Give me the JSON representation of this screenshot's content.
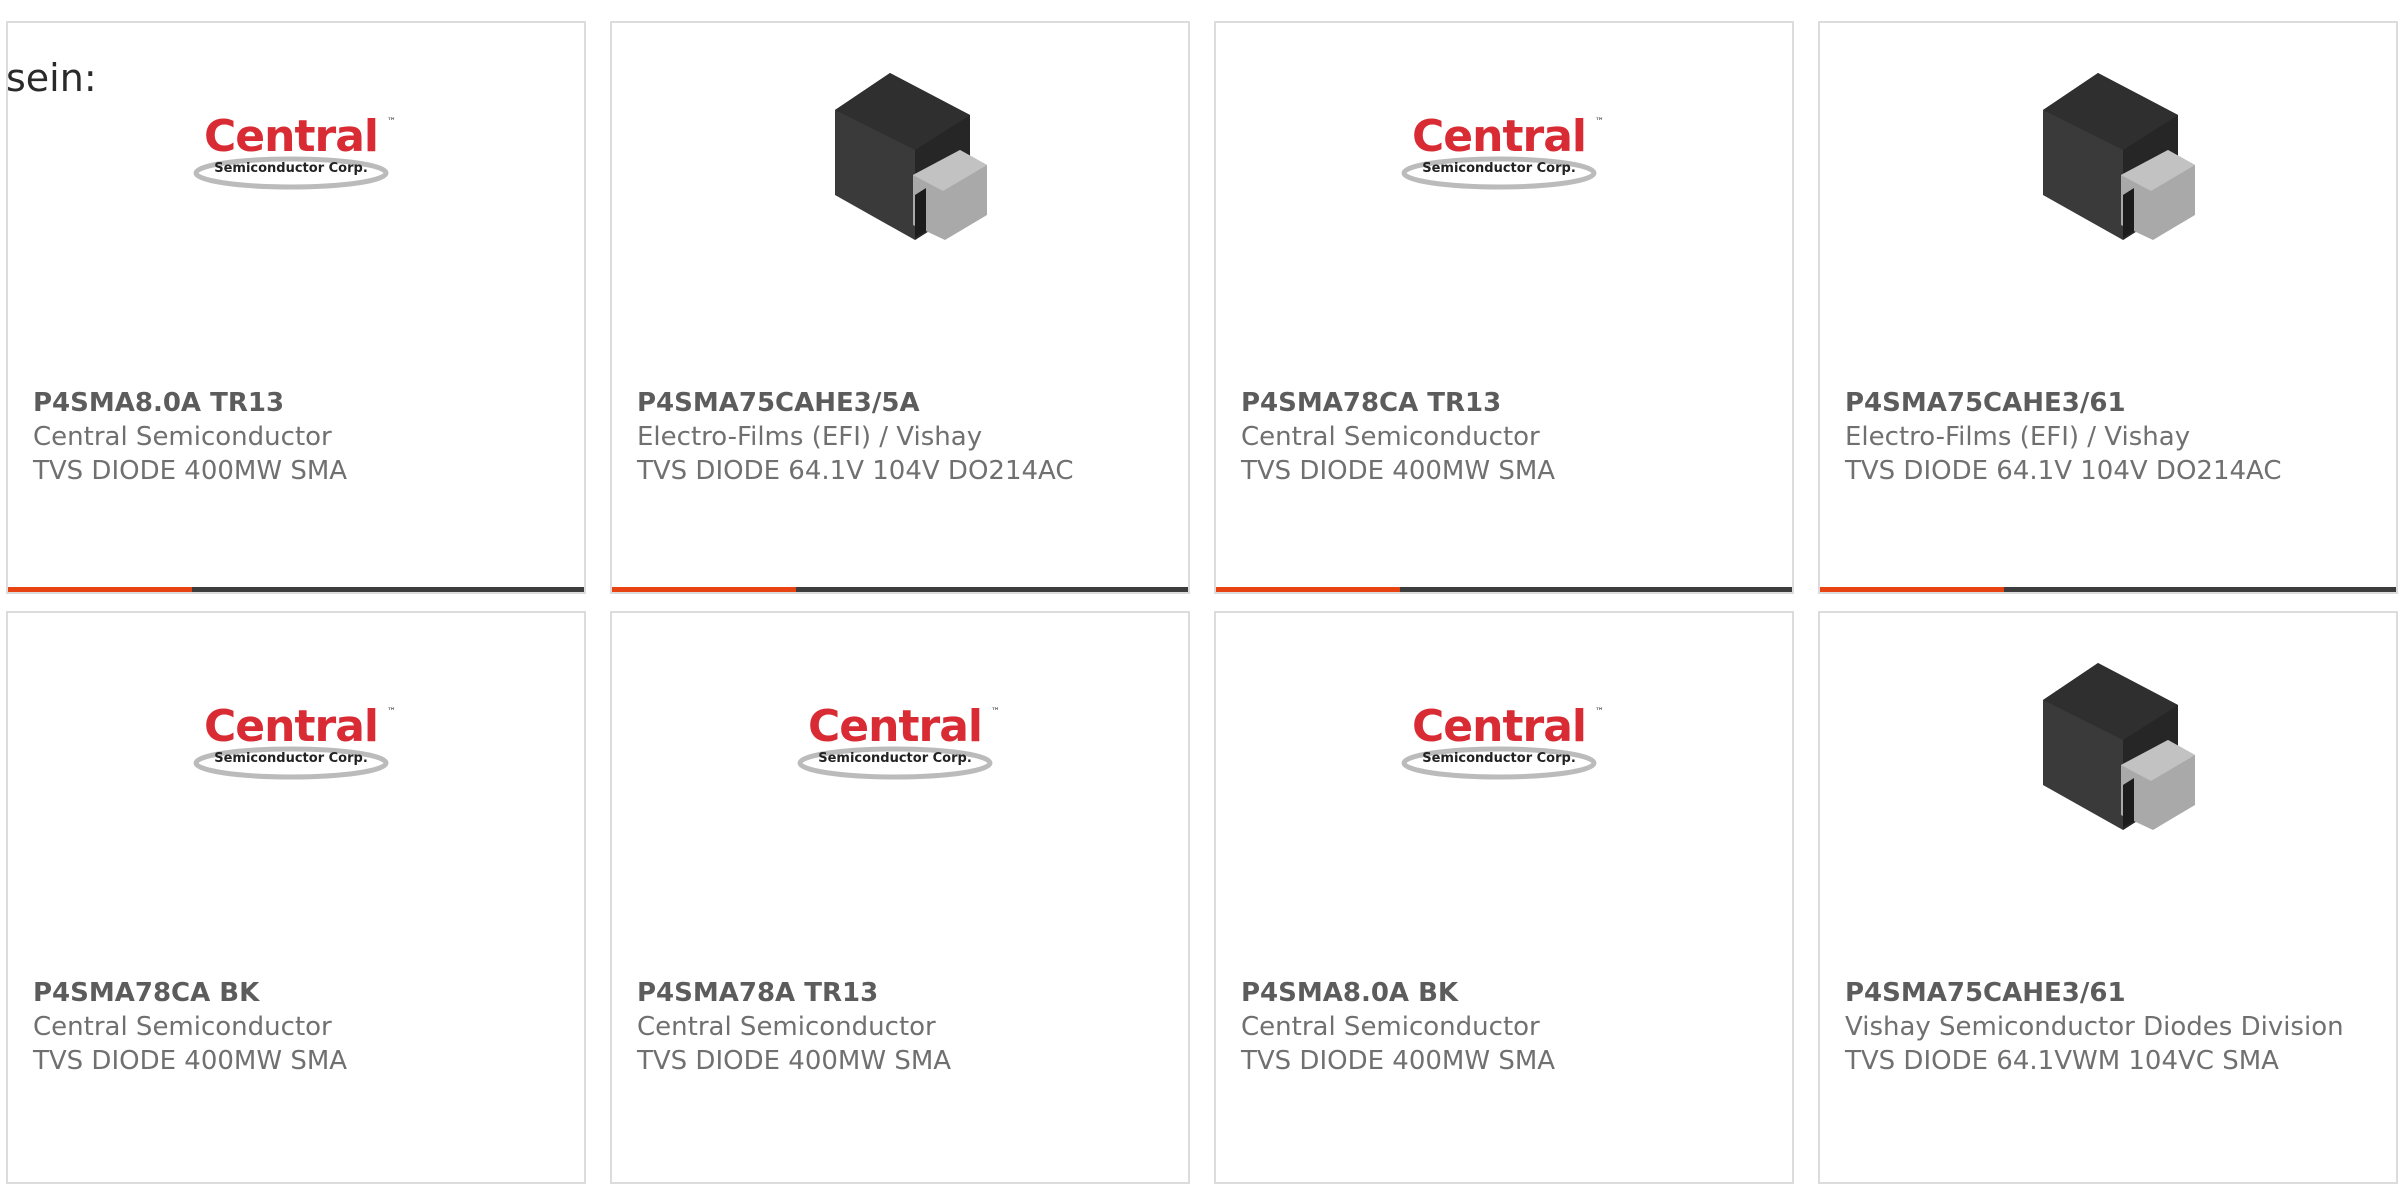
{
  "leading_text": "sein:",
  "colors": {
    "accent": "#e84312",
    "track": "#3d3d3d",
    "logo_red": "#d82b33"
  },
  "products": [
    {
      "part": "P4SMA8.0A TR13",
      "manufacturer": "Central Semiconductor",
      "description": "TVS DIODE 400MW SMA",
      "image": "central-logo",
      "logo_word": "Central",
      "logo_sub": "Semiconductor Corp.",
      "progress": 0.32
    },
    {
      "part": "P4SMA75CAHE3/5A",
      "manufacturer": "Electro-Films (EFI) / Vishay",
      "description": "TVS DIODE 64.1V 104V DO214AC",
      "image": "sma-package",
      "progress": 0.32
    },
    {
      "part": "P4SMA78CA TR13",
      "manufacturer": "Central Semiconductor",
      "description": "TVS DIODE 400MW SMA",
      "image": "central-logo",
      "logo_word": "Central",
      "logo_sub": "Semiconductor Corp.",
      "progress": 0.32
    },
    {
      "part": "P4SMA75CAHE3/61",
      "manufacturer": "Electro-Films (EFI) / Vishay",
      "description": "TVS DIODE 64.1V 104V DO214AC",
      "image": "sma-package",
      "progress": 0.32
    },
    {
      "part": "P4SMA78CA BK",
      "manufacturer": "Central Semiconductor",
      "description": "TVS DIODE 400MW SMA",
      "image": "central-logo",
      "logo_word": "Central",
      "logo_sub": "Semiconductor Corp."
    },
    {
      "part": "P4SMA78A TR13",
      "manufacturer": "Central Semiconductor",
      "description": "TVS DIODE 400MW SMA",
      "image": "central-logo",
      "logo_word": "Central",
      "logo_sub": "Semiconductor Corp."
    },
    {
      "part": "P4SMA8.0A BK",
      "manufacturer": "Central Semiconductor",
      "description": "TVS DIODE 400MW SMA",
      "image": "central-logo",
      "logo_word": "Central",
      "logo_sub": "Semiconductor Corp."
    },
    {
      "part": "P4SMA75CAHE3/61",
      "manufacturer": "Vishay Semiconductor Diodes Division",
      "description": "TVS DIODE 64.1VWM 104VC SMA",
      "image": "sma-package"
    }
  ]
}
